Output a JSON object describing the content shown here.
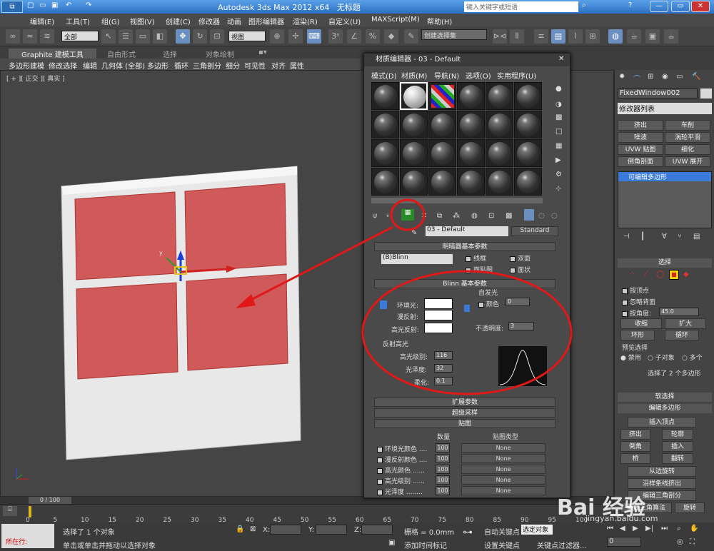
{
  "titlebar": {
    "app": "Autodesk 3ds Max  2012 x64",
    "doc": "无标题",
    "search_placeholder": "键入关键字或短语"
  },
  "menu": [
    "编辑(E)",
    "工具(T)",
    "组(G)",
    "视图(V)",
    "创建(C)",
    "修改器",
    "动画",
    "图形编辑器",
    "渲染(R)",
    "自定义(U)",
    "MAXScript(M)",
    "帮助(H)"
  ],
  "toolbar": {
    "selection_filter": "全部",
    "ref_coord": "视图",
    "named_sel": "创建选择集"
  },
  "ribbon": {
    "tabs": [
      "Graphite 建模工具",
      "自由形式",
      "选择",
      "对象绘制"
    ],
    "panel": [
      "多边形建模",
      "修改选择",
      "编辑",
      "几何体 (全部)",
      "多边形",
      "循环",
      "三角剖分",
      "细分",
      "可见性",
      "对齐",
      "属性"
    ]
  },
  "viewport": {
    "label": "[ + ][ 正交 ][ 真实 ]"
  },
  "material_editor": {
    "title": "材质编辑器 - 03 - Default",
    "menu": [
      "模式(D)",
      "材质(M)",
      "导航(N)",
      "选项(O)",
      "实用程序(U)"
    ],
    "material_name": "03 - Default",
    "material_type": "Standard",
    "shader_basic": {
      "title": "明暗器基本参数",
      "shader": "(B)Blinn",
      "wire": "线框",
      "two_sided": "双面",
      "face_map": "面贴图",
      "faceted": "面状"
    },
    "blinn_basic": {
      "title": "Blinn 基本参数",
      "self_illum": "自发光",
      "color": "颜色",
      "self_illum_val": "0",
      "ambient": "环境光:",
      "diffuse": "漫反射:",
      "specular": "高光反射:",
      "opacity": "不透明度:",
      "opacity_val": "3"
    },
    "specular_hl": {
      "title": "反射高光",
      "level": "高光级别:",
      "level_val": "116",
      "gloss": "光泽度:",
      "gloss_val": "32",
      "soften": "柔化:",
      "soften_val": "0.1"
    },
    "rollups": [
      "扩展参数",
      "超级采样",
      "贴图"
    ],
    "maps": {
      "col_amount": "数量",
      "col_type": "贴图类型",
      "rows": [
        {
          "name": "环境光颜色 ....",
          "amount": "100",
          "map": "None"
        },
        {
          "name": "漫反射颜色 ....",
          "amount": "100",
          "map": "None"
        },
        {
          "name": "高光颜色 ......",
          "amount": "100",
          "map": "None"
        },
        {
          "name": "高光级别 ......",
          "amount": "100",
          "map": "None"
        },
        {
          "name": "光泽度 ........",
          "amount": "100",
          "map": "None"
        }
      ]
    }
  },
  "command_panel": {
    "object_name": "FixedWindow002",
    "modifier_list": "修改器列表",
    "mod_buttons": [
      "挤出",
      "车削",
      "噪波",
      "涡轮平滑",
      "UVW 贴图",
      "细化",
      "倒角剖面",
      "UVW 展开"
    ],
    "stack_item": "可编辑多边形",
    "selection": {
      "title": "选择",
      "by_vertex": "按顶点",
      "ignore_back": "忽略背面",
      "by_angle": "按角度:",
      "angle_val": "45.0",
      "shrink": "收缩",
      "grow": "扩大",
      "ring": "环形",
      "loop": "循环",
      "preview": "预览选择",
      "disabled": "禁用",
      "subobj": "子对象",
      "multi": "多个",
      "status": "选择了 2 个多边形"
    },
    "soft_sel": "软选择",
    "edit_poly": {
      "title": "编辑多边形",
      "insert_vertex": "插入顶点",
      "buttons": [
        "挤出",
        "轮廓",
        "倒角",
        "插入",
        "桥",
        "翻转",
        "从边旋转",
        "沿样条线挤出",
        "编辑三角剖分",
        "重复三角算法",
        "旋转"
      ]
    }
  },
  "timeline": {
    "frame": "0 / 100",
    "ticks": [
      "0",
      "5",
      "10",
      "15",
      "20",
      "25",
      "30",
      "35",
      "40",
      "45",
      "50",
      "55",
      "60",
      "65",
      "70",
      "75",
      "80",
      "85",
      "90",
      "95",
      "100"
    ]
  },
  "status": {
    "running": "所在行:",
    "msg1": "选择了 1 个对象",
    "msg2": "单击或单击并拖动以选择对象",
    "x": "X:",
    "y": "Y:",
    "z": "Z:",
    "grid": "栅格 = 0.0mm",
    "add_time_tag": "添加时间标记",
    "auto_key": "自动关键点",
    "set_key": "设置关键点",
    "selected": "选定对象",
    "key_filter": "关键点过滤器...",
    "frame_val": "0"
  },
  "watermark": "Bai 经验",
  "watermark_url": "jingyan.baidu.com",
  "colors": {
    "window_pane": "#d05a5a",
    "frame": "#e8e8e8",
    "annotation": "#e01818"
  }
}
